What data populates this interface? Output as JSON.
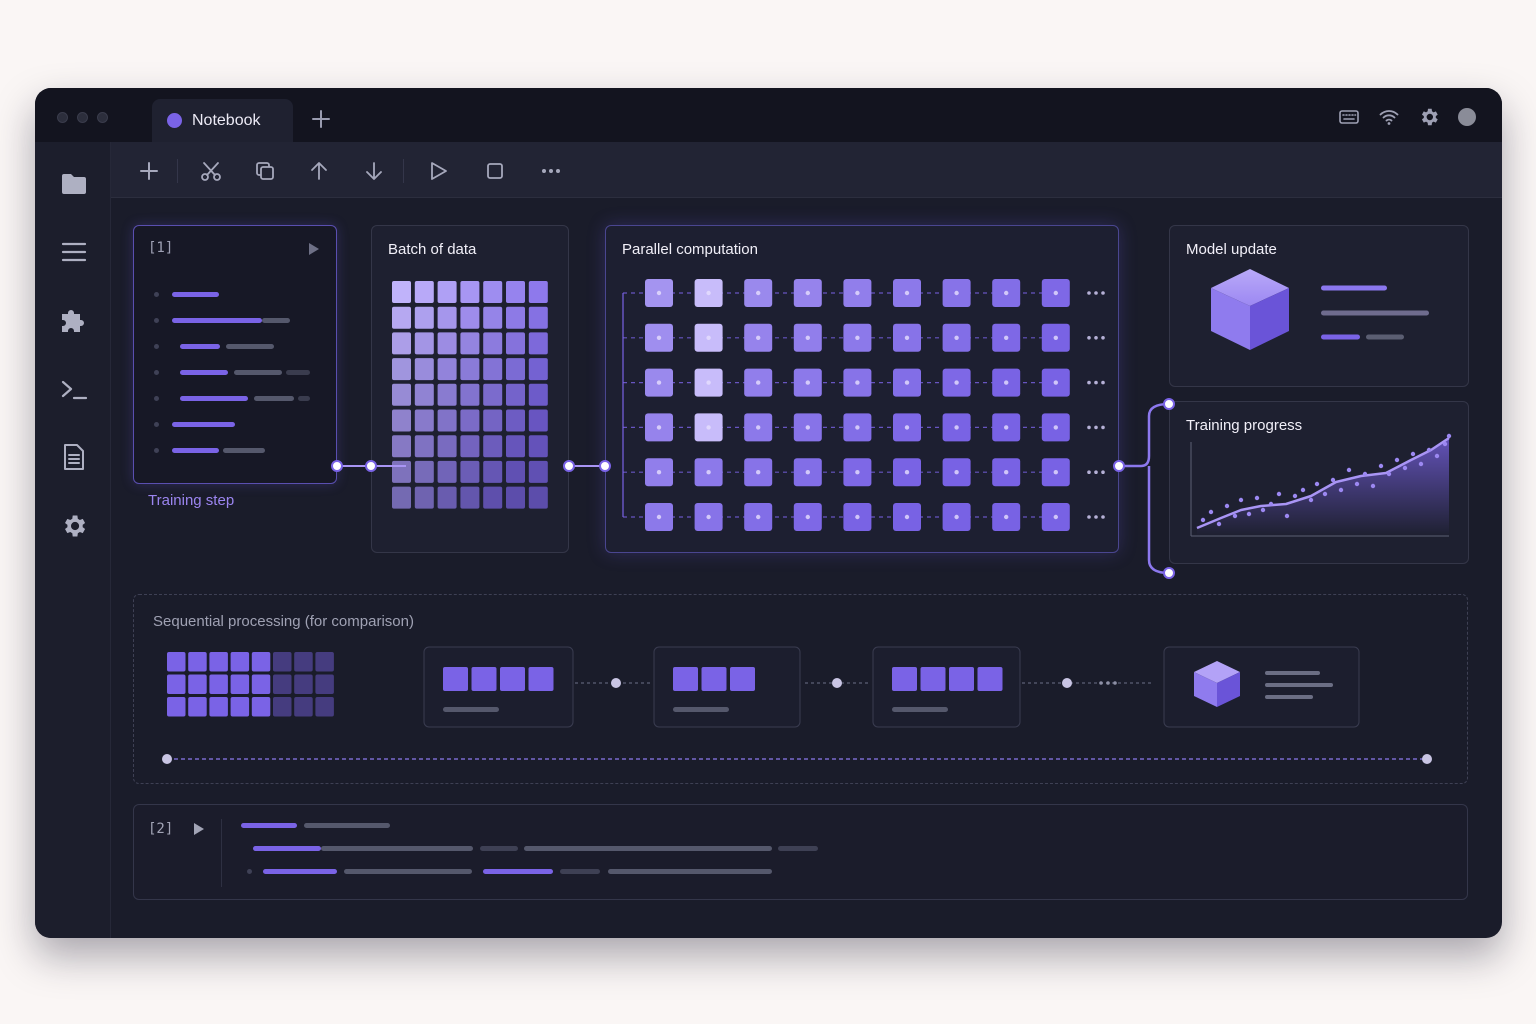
{
  "tab": {
    "label": "Notebook"
  },
  "cells": {
    "first": {
      "number": "[1]",
      "caption": "Training step"
    },
    "second": {
      "number": "[2]"
    }
  },
  "panels": {
    "batch": {
      "title": "Batch of data"
    },
    "parallel": {
      "title": "Parallel computation"
    },
    "model_update": {
      "title": "Model update"
    },
    "training_progress": {
      "title": "Training progress"
    },
    "sequential": {
      "title": "Sequential processing (for comparison)"
    }
  },
  "colors": {
    "accent": "#7a63e6",
    "accent_light": "#a995f5",
    "window_bg": "#1a1c2a",
    "panel_border": "#343648"
  },
  "icons": {
    "titlebar": [
      "keyboard-icon",
      "wifi-icon",
      "gear-icon",
      "avatar"
    ],
    "sidebar": [
      "folder-icon",
      "menu-icon",
      "puzzle-icon",
      "terminal-icon",
      "document-icon",
      "settings-icon"
    ],
    "toolbar": [
      "plus-icon",
      "cut-icon",
      "copy-icon",
      "arrow-up-icon",
      "arrow-down-icon",
      "play-icon",
      "stop-icon",
      "more-icon"
    ]
  }
}
